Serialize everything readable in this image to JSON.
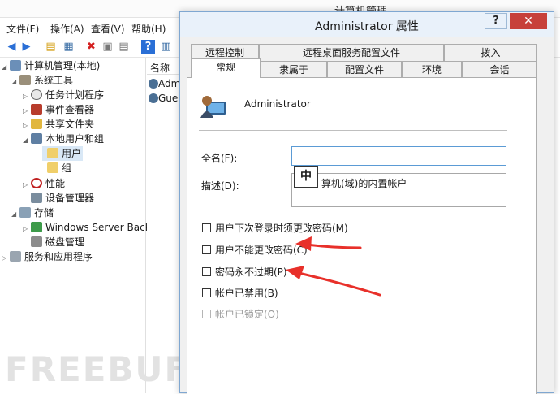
{
  "back_window": {
    "title": "计算机管理",
    "menu": [
      "文件(F)",
      "操作(A)",
      "查看(V)",
      "帮助(H)"
    ],
    "tree": [
      {
        "label": "计算机管理(本地)"
      },
      {
        "label": "系统工具"
      },
      {
        "label": "任务计划程序"
      },
      {
        "label": "事件查看器"
      },
      {
        "label": "共享文件夹"
      },
      {
        "label": "本地用户和组"
      },
      {
        "label": "用户"
      },
      {
        "label": "组"
      },
      {
        "label": "性能"
      },
      {
        "label": "设备管理器"
      },
      {
        "label": "存储"
      },
      {
        "label": "Windows Server Back"
      },
      {
        "label": "磁盘管理"
      },
      {
        "label": "服务和应用程序"
      }
    ],
    "list_header": "名称",
    "list_rows": [
      "Admi",
      "Gue"
    ],
    "watermark": "FREEBUF"
  },
  "dialog": {
    "title": "Administrator 属性",
    "help_label": "?",
    "close_label": "✕",
    "tabs_row1": [
      "远程控制",
      "远程桌面服务配置文件",
      "拨入"
    ],
    "tabs_row2": [
      "常规",
      "隶属于",
      "配置文件",
      "环境",
      "会话"
    ],
    "user_name": "Administrator",
    "fullname_label": "全名(F):",
    "fullname_value": "",
    "description_label": "描述(D):",
    "description_value": "算机(域)的内置帐户",
    "ime_indicator": "中",
    "checkboxes": [
      {
        "label": "用户下次登录时须更改密码(M)",
        "checked": false,
        "enabled": true
      },
      {
        "label": "用户不能更改密码(C)",
        "checked": false,
        "enabled": true
      },
      {
        "label": "密码永不过期(P)",
        "checked": false,
        "enabled": true
      },
      {
        "label": "帐户已禁用(B)",
        "checked": false,
        "enabled": true
      },
      {
        "label": "帐户已锁定(O)",
        "checked": false,
        "enabled": false
      }
    ]
  },
  "colors": {
    "annotation_arrow": "#e8302a",
    "selection": "#d9e8f6",
    "close_button": "#c7403a"
  }
}
